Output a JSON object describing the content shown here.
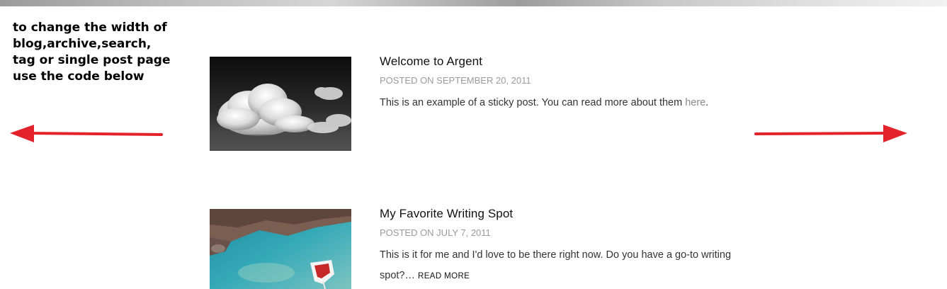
{
  "annotation": {
    "lines": [
      "to change the width of",
      "blog,archive,search,",
      "tag or single post page",
      "use the code below"
    ]
  },
  "colors": {
    "arrow": "#e3222b",
    "meta": "#9a9a9a",
    "link": "#8a8a8a"
  },
  "posts": [
    {
      "title": "Welcome to Argent",
      "meta": "POSTED ON SEPTEMBER 20, 2011",
      "excerpt": "This is an example of a sticky post. You can read more about them ",
      "link_text": "here",
      "excerpt_end": "."
    },
    {
      "title": "My Favorite Writing Spot",
      "meta": "POSTED ON JULY 7, 2011",
      "excerpt": "This is it for me and I'd love to be there right now.  Do you have a go-to writing spot?… ",
      "read_more": "READ MORE"
    }
  ]
}
